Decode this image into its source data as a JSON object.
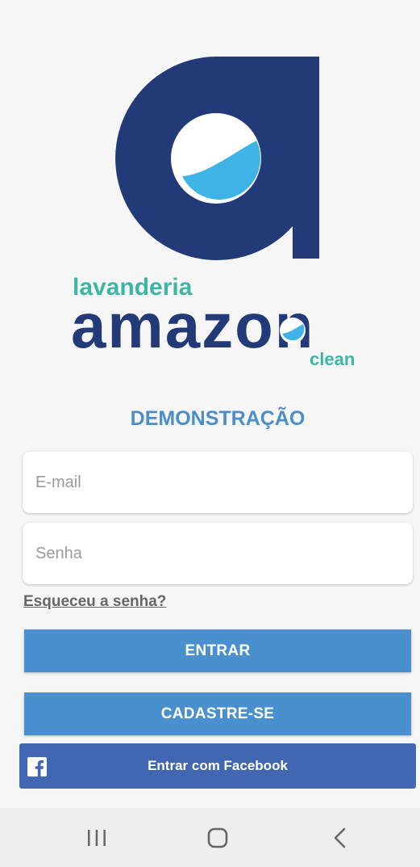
{
  "brand": {
    "line_top": "lavanderia",
    "line_main": "amazon",
    "line_bottom": "clean",
    "colors": {
      "navy": "#223a78",
      "teal": "#3db6a6",
      "light_blue": "#3fb3e6"
    }
  },
  "page": {
    "title": "DEMONSTRAÇÃO",
    "title_color": "#4b8fc9"
  },
  "form": {
    "email_placeholder": "E-mail",
    "password_placeholder": "Senha",
    "forgot_label": "Esqueceu a senha?"
  },
  "buttons": {
    "login_label": "ENTRAR",
    "signup_label": "CADASTRE-SE",
    "facebook_label": "Entrar com Facebook",
    "primary_color": "#4a90cf",
    "facebook_color": "#4267b2"
  },
  "icons": {
    "facebook": "facebook-icon",
    "nav_recent": "recent-apps-icon",
    "nav_home": "home-icon",
    "nav_back": "back-icon"
  }
}
